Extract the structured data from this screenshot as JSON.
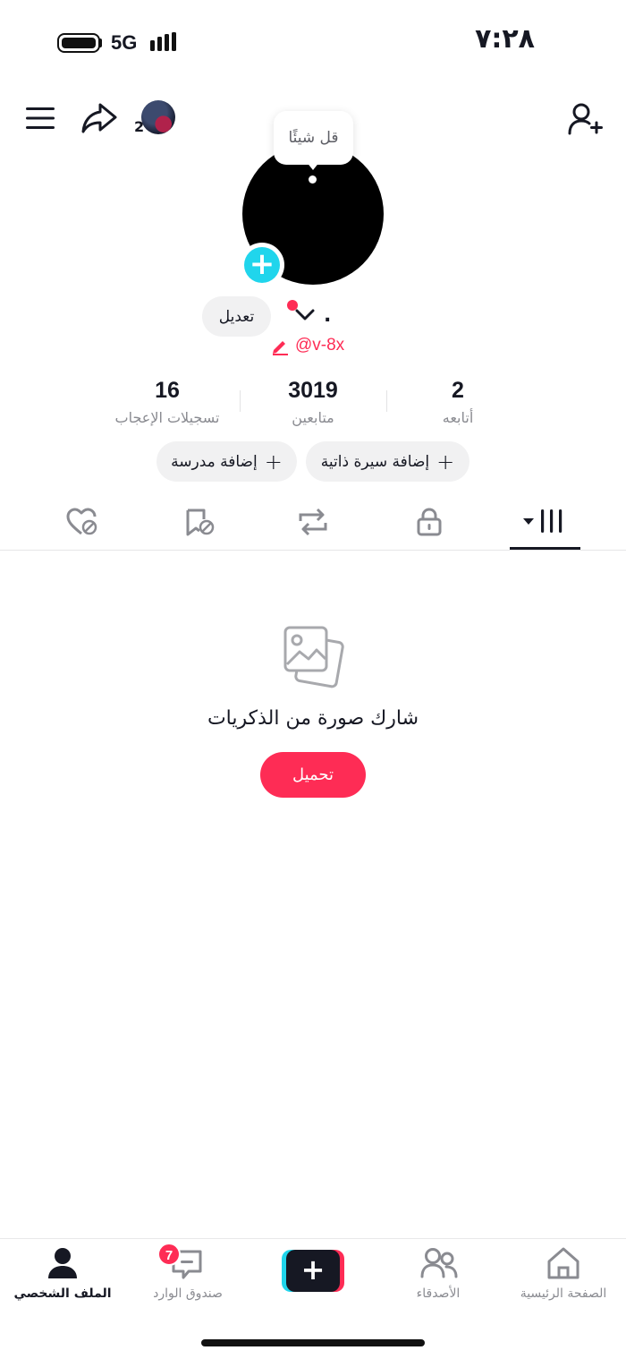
{
  "status_bar": {
    "time": "٧:٢٨",
    "network": "5G"
  },
  "top_bar": {
    "story_count": "2"
  },
  "profile": {
    "bubble_text": "قل شيئًا",
    "edit_label": "تعديل",
    "name": ".",
    "handle": "@v-8x"
  },
  "stats": {
    "likes": {
      "value": "16",
      "label": "تسجيلات الإعجاب"
    },
    "followers": {
      "value": "3019",
      "label": "متابعين"
    },
    "following": {
      "value": "2",
      "label": "أتابعه"
    }
  },
  "pills": {
    "add_school": "إضافة مدرسة",
    "add_bio": "إضافة سيرة ذاتية"
  },
  "tabs": [
    "liked-icon",
    "favorites-icon",
    "reposts-icon",
    "private-icon",
    "videos-grid-icon"
  ],
  "empty_state": {
    "title": "شارك صورة من الذكريات",
    "button": "تحميل"
  },
  "bottom_nav": {
    "profile": "الملف الشخصي",
    "inbox": "صندوق الوارد",
    "friends": "الأصدقاء",
    "home": "الصفحة الرئيسية",
    "inbox_badge": "7"
  },
  "colors": {
    "accent": "#fe2c55",
    "cyan": "#20d5ec",
    "text": "#161823",
    "muted": "#8a8b91"
  }
}
